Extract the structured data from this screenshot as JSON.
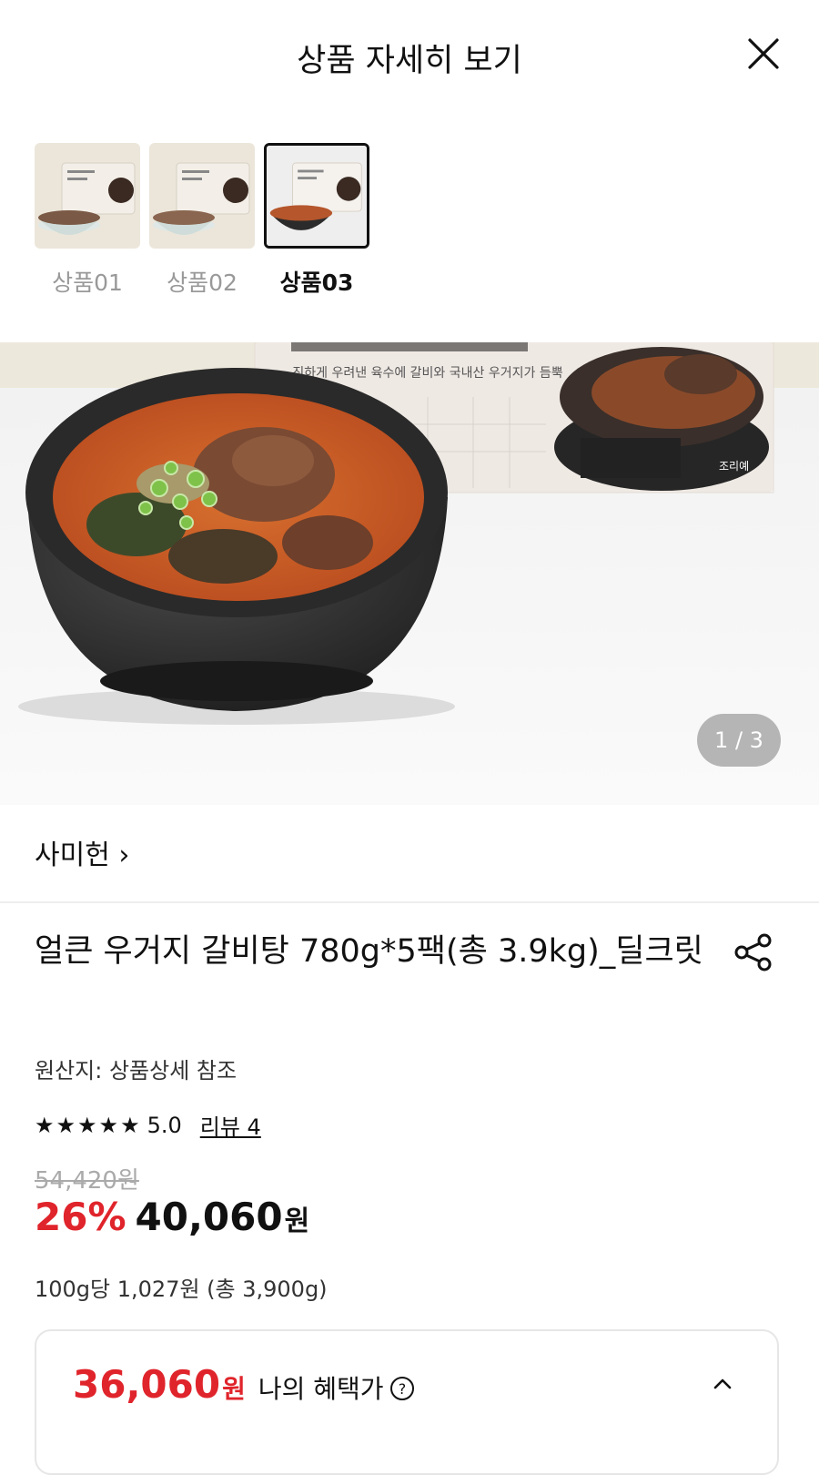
{
  "header": {
    "title": "상품 자세히 보기"
  },
  "thumbnails": [
    {
      "label": "상품01",
      "active": false
    },
    {
      "label": "상품02",
      "active": false
    },
    {
      "label": "상품03",
      "active": true
    }
  ],
  "hero": {
    "counter": "1 / 3",
    "caption": "진하게 우려낸 육수에 갈비와 국내산 우거지가 듬뿍"
  },
  "brand": {
    "label": "사미헌 ›"
  },
  "product": {
    "title": "얼큰 우거지 갈비탕 780g*5팩(총 3.9kg)_딜크릿",
    "origin": "원산지: 상품상세 참조",
    "stars": [
      "★",
      "★",
      "★",
      "★",
      "★"
    ],
    "rating": "5.0",
    "review_link": "리뷰 4",
    "original_price": "54,420원",
    "discount": "26%",
    "sale_price": "40,060",
    "sale_currency": "원",
    "unit_price": "100g당 1,027원 (총 3,900g)"
  },
  "benefit": {
    "price": "36,060",
    "currency": "원",
    "label": "나의 혜택가"
  }
}
